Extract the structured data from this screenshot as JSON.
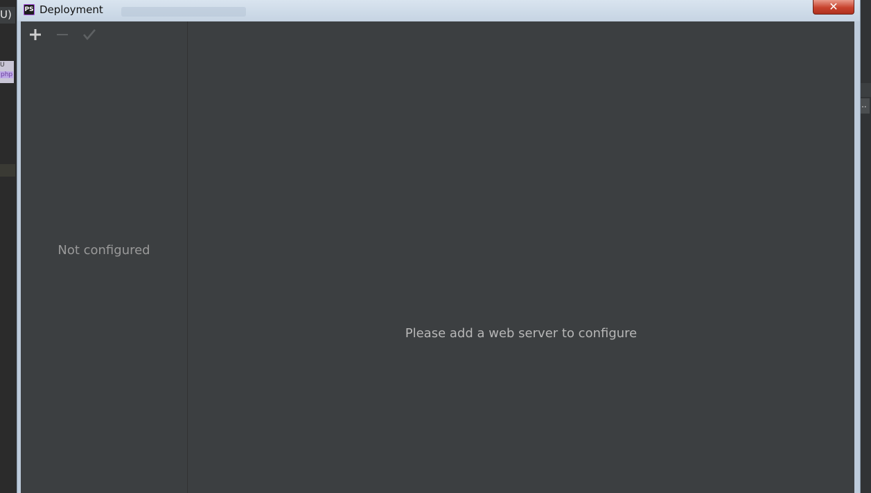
{
  "background": {
    "menu_fragment": "U)",
    "tab_fragment_top": "U",
    "tab_fragment_php": "php",
    "more_button": "..."
  },
  "dialog": {
    "title": "Deployment",
    "app_icon_label": "PS",
    "close_label": "✕"
  },
  "toolbar": {
    "add_label": "Add",
    "remove_label": "Remove",
    "apply_label": "Apply"
  },
  "left_panel": {
    "empty_text": "Not configured"
  },
  "right_panel": {
    "empty_text": "Please add a web server to configure"
  },
  "colors": {
    "panel_bg": "#3c3f41",
    "muted_text": "#9a9a9a",
    "message_text": "#b7b7b7",
    "close_red": "#c7432e"
  }
}
